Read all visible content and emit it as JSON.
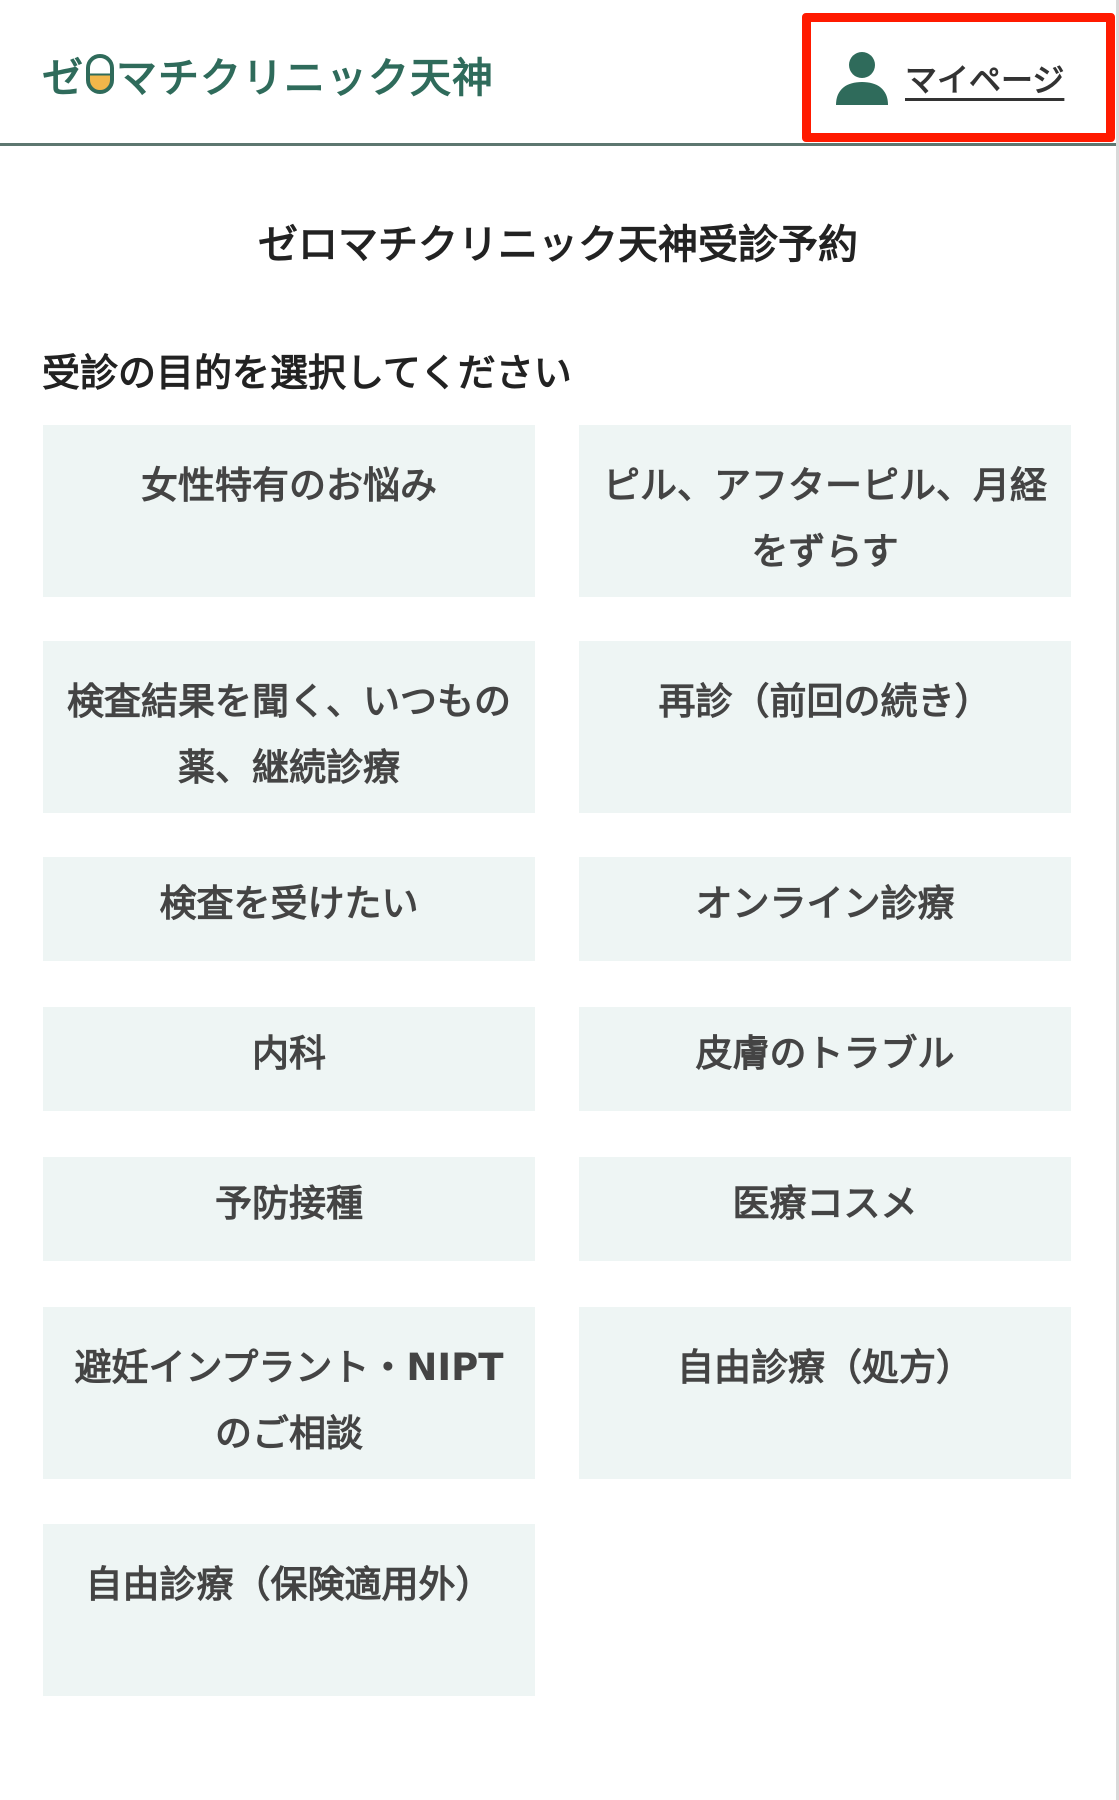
{
  "header": {
    "logo_text_before": "ゼ",
    "logo_text_after": "マチクリニック天神",
    "mypage_label": "マイページ"
  },
  "main": {
    "title": "ゼロマチクリニック天神受診予約",
    "section_heading": "受診の目的を選択してください",
    "options": [
      "女性特有のお悩み",
      "ピル、アフターピル、月経をずらす",
      "検査結果を聞く、いつもの薬、継続診療",
      "再診（前回の続き）",
      "検査を受けたい",
      "オンライン診療",
      "内科",
      "皮膚のトラブル",
      "予防接種",
      "医療コスメ",
      "避妊インプラント・NIPTのご相談",
      "自由診療（処方）",
      "自由診療（保険適用外）"
    ]
  },
  "colors": {
    "brand": "#2f6b5b",
    "accent": "#f1b64a",
    "option_bg": "#eef5f4",
    "highlight": "#ff1a00"
  }
}
